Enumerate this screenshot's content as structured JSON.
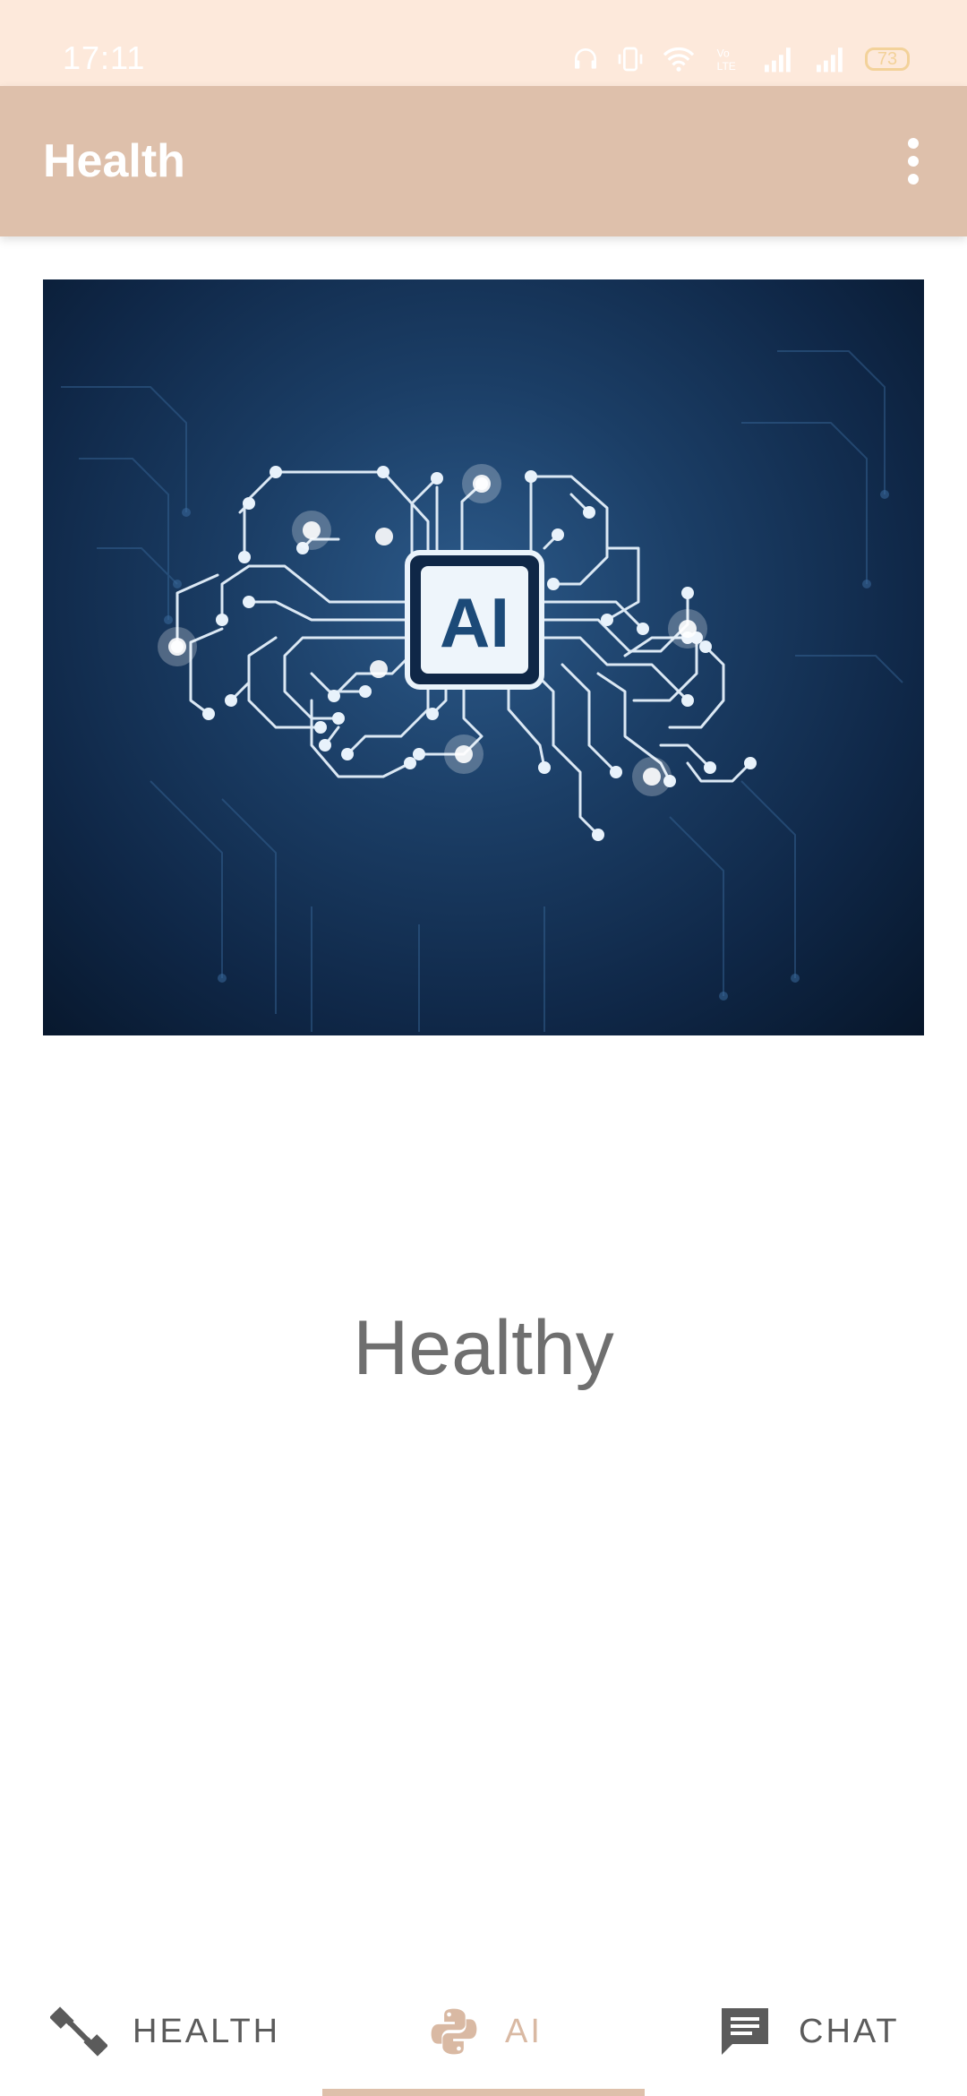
{
  "status_bar": {
    "time": "17:11",
    "battery_level": "73",
    "icons": [
      "headphones-icon",
      "vibrate-icon",
      "wifi-icon",
      "volte-icon",
      "signal-icon",
      "signal-icon",
      "battery-icon"
    ]
  },
  "app_bar": {
    "title": "Health",
    "menu_icon": "more-vertical-icon"
  },
  "hero": {
    "image_text": "AI"
  },
  "main": {
    "status_text": "Healthy"
  },
  "bottom_nav": {
    "items": [
      {
        "label": "HEALTH",
        "icon": "dumbbell-icon",
        "active": false
      },
      {
        "label": "AI",
        "icon": "python-icon",
        "active": true
      },
      {
        "label": "CHAT",
        "icon": "chat-icon",
        "active": false
      }
    ],
    "active_color": "#dec0ab",
    "inactive_color": "#5b5b5b"
  },
  "colors": {
    "status_bar": "#fde9db",
    "app_bar": "#dec0ab",
    "accent": "#dec0ab"
  }
}
